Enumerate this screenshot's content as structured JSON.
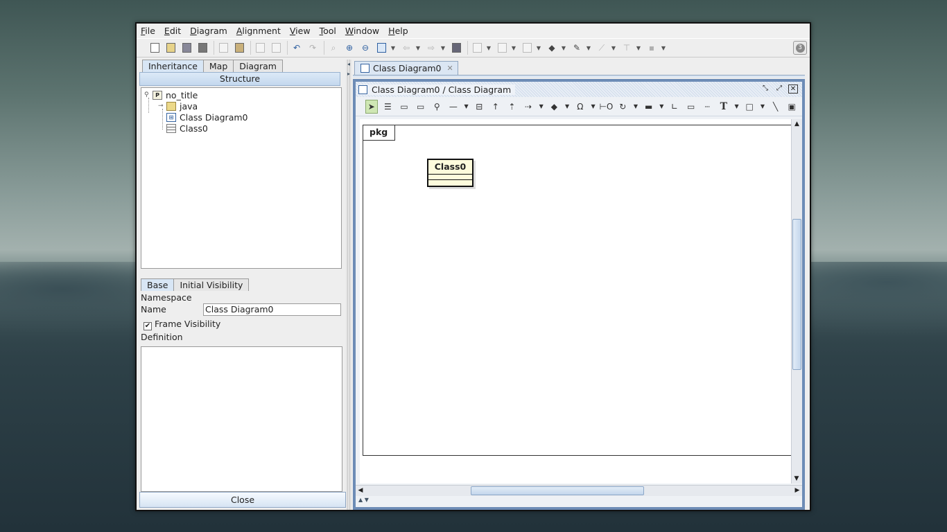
{
  "menu": [
    "File",
    "Edit",
    "Diagram",
    "Alignment",
    "View",
    "Tool",
    "Window",
    "Help"
  ],
  "left_tabs": [
    "Inheritance",
    "Map",
    "Diagram"
  ],
  "structure_header": "Structure",
  "tree": {
    "root": "no_title",
    "children": [
      "java",
      "Class Diagram0",
      "Class0"
    ]
  },
  "prop_tabs": [
    "Base",
    "Initial Visibility"
  ],
  "props": {
    "namespace_label": "Namespace",
    "name_label": "Name",
    "name_value": "Class Diagram0",
    "frame_visibility_label": "Frame Visibility",
    "frame_visibility_checked": true,
    "definition_label": "Definition"
  },
  "close_label": "Close",
  "doc_tab": "Class Diagram0",
  "inner_title": "Class Diagram0 / Class Diagram",
  "diagram": {
    "frame_label": "pkg",
    "class_name": "Class0"
  },
  "colors": {
    "class_fill": "#fdfbdc",
    "frame_border": "#6d8cb6",
    "selected_tool": "#cfe7b4"
  },
  "icons": [
    "search-icon",
    "zoom-in-icon",
    "zoom-out-icon",
    "undo-icon",
    "redo-icon",
    "help-icon"
  ]
}
